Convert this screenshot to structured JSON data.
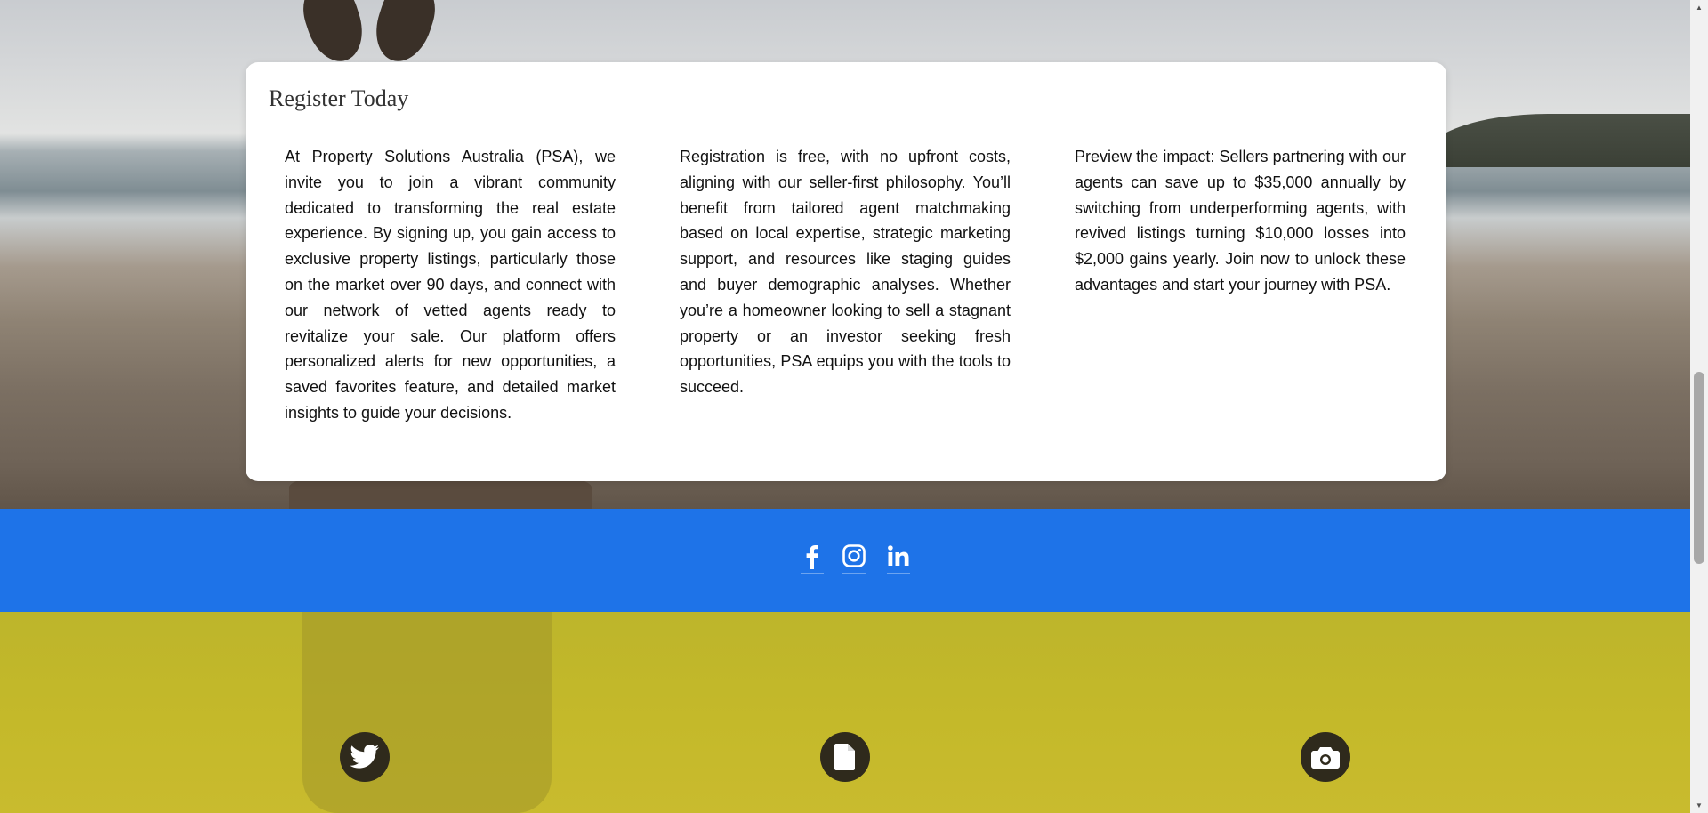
{
  "register": {
    "title": "Register Today",
    "col1": "At Property Solutions Australia (PSA), we invite you to join a vibrant community dedicated to transforming the real estate experience. By signing up, you gain access to exclusive property listings, particularly those on the market over 90 days, and connect with our network of vetted agents ready to revitalize your sale. Our platform offers personalized alerts for new opportunities, a saved favorites feature, and detailed market insights to guide your decisions.",
    "col2": "Registration is free, with no upfront costs, aligning with our seller-first philosophy. You’ll benefit from tailored agent matchmaking based on local expertise, strategic marketing support, and resources like staging guides and buyer demographic analyses. Whether you’re a homeowner looking to sell a stagnant property or an investor seeking fresh opportunities, PSA equips you with the tools to succeed.",
    "col3": "Preview the impact: Sellers partnering with our agents can save up to $35,000 annually by switching from underperforming agents, with revived listings turning $10,000 losses into $2,000 gains yearly. Join now to unlock these advantages and start your journey with PSA."
  },
  "social": {
    "icons": [
      "facebook-icon",
      "instagram-icon",
      "linkedin-icon"
    ]
  },
  "features": {
    "icons": [
      "twitter-icon",
      "document-icon",
      "camera-icon"
    ]
  },
  "colors": {
    "social_bar": "#1e73e8",
    "yellow_section": "#c4b92a",
    "card": "#ffffff",
    "round_icon": "#2f2a1c"
  },
  "scrollbar": {
    "up_arrow": "▲",
    "down_arrow": "▼"
  }
}
